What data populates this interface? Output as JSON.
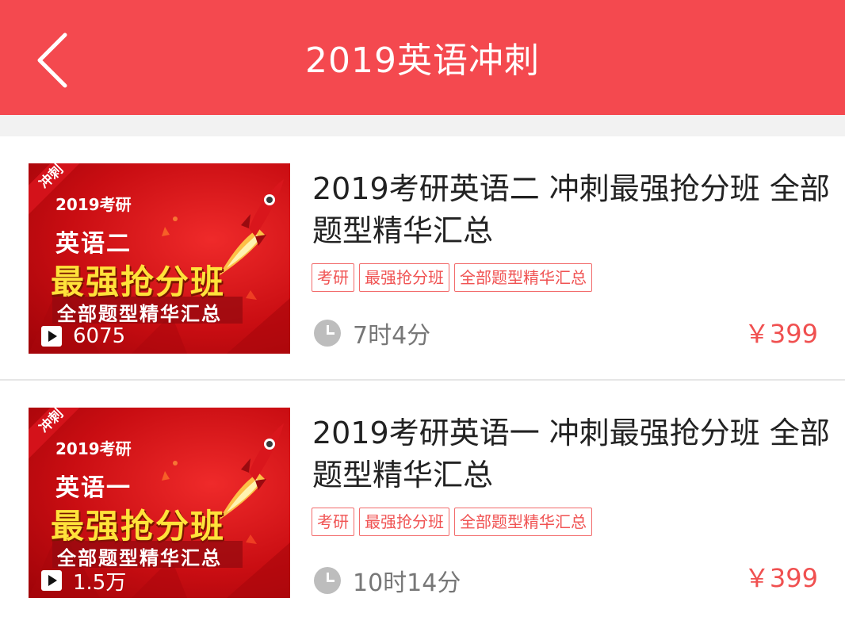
{
  "header": {
    "title": "2019英语冲刺",
    "background": "#f4494f"
  },
  "courses": [
    {
      "thumbnail": {
        "ribbon": "冲刺",
        "year": "2019考研",
        "subject": "英语二",
        "headline": "最强抢分班",
        "subline": "全部题型精华汇总",
        "views": "6075"
      },
      "title": "2019考研英语二 冲刺最强抢分班 全部题型精华汇总",
      "tags": [
        "考研",
        "最强抢分班",
        "全部题型精华汇总"
      ],
      "duration": "7时4分",
      "price": "￥399"
    },
    {
      "thumbnail": {
        "ribbon": "冲刺",
        "year": "2019考研",
        "subject": "英语一",
        "headline": "最强抢分班",
        "subline": "全部题型精华汇总",
        "views": "1.5万"
      },
      "title": "2019考研英语一 冲刺最强抢分班 全部题型精华汇总",
      "tags": [
        "考研",
        "最强抢分班",
        "全部题型精华汇总"
      ],
      "duration": "10时14分",
      "price": "￥399"
    }
  ],
  "icons": {
    "back": "chevron-left-icon",
    "play": "play-icon",
    "clock": "clock-icon",
    "rocket": "rocket-icon"
  },
  "colors": {
    "accent": "#f4494f",
    "price": "#f05050",
    "tag_border": "#f26b6b"
  }
}
